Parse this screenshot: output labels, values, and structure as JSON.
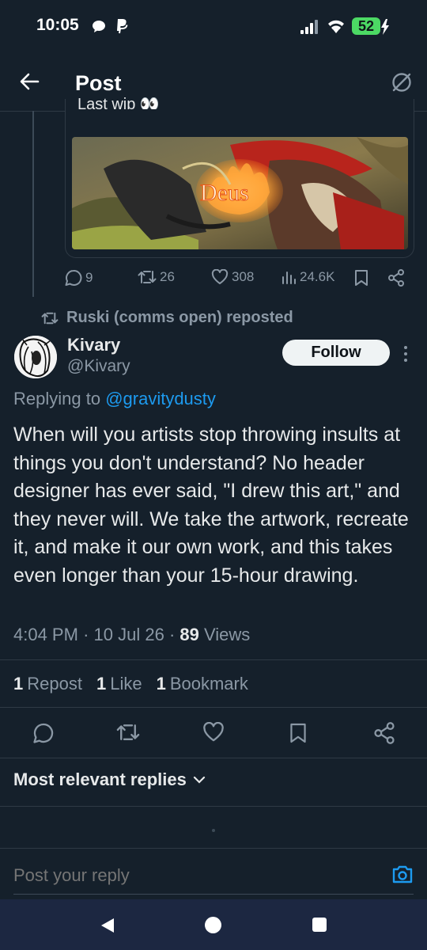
{
  "status_bar": {
    "time": "10:05",
    "battery": "52",
    "icons": [
      "chat-bubble-icon",
      "paypal-icon",
      "signal-icon",
      "wifi-icon",
      "battery-charging-icon"
    ],
    "battery_color": "#4cd964"
  },
  "header": {
    "title": "Post",
    "back_icon": "arrow-left-icon",
    "right_icon": "no-image-icon"
  },
  "quoted_post": {
    "text": "Last wip 👀",
    "image_text": "Deus",
    "metrics": {
      "replies": "9",
      "reposts": "26",
      "likes": "308",
      "views": "24.6K"
    }
  },
  "repost_banner": {
    "text": "Ruski (comms open) reposted"
  },
  "tweet": {
    "display_name": "Kivary",
    "handle": "@Kivary",
    "follow_label": "Follow",
    "replying_prefix": "Replying to ",
    "replying_to": "@gravitydusty",
    "body": "When will you artists stop throwing insults at things you don't understand? No header designer has ever said, \"I drew this art,\" and they never will. We take the artwork, recreate it, and make it our own work, and this takes even longer than your 15-hour drawing.",
    "time": "4:04 PM",
    "date": "10 Jul 26",
    "views_count": "89",
    "views_label": "Views",
    "stats": {
      "reposts_count": "1",
      "reposts_label": "Repost",
      "likes_count": "1",
      "likes_label": "Like",
      "bookmarks_count": "1",
      "bookmarks_label": "Bookmark"
    }
  },
  "replies": {
    "sort_label": "Most relevant replies"
  },
  "reply_bar": {
    "placeholder": "Post your reply"
  },
  "colors": {
    "background": "#15202b",
    "accent": "#1d9bf0",
    "muted": "#8b98a5",
    "text": "#e7e9ea"
  }
}
